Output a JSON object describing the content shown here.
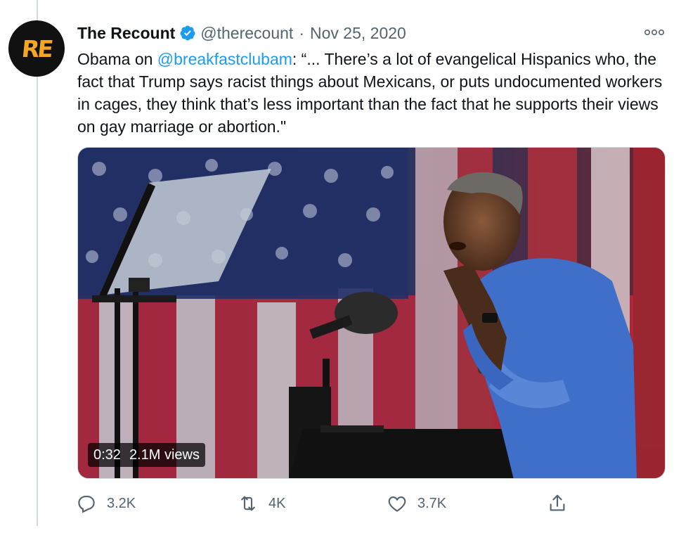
{
  "tweet": {
    "author": {
      "display_name": "The Recount",
      "handle": "@therecount",
      "verified": true,
      "avatar_text": "RE",
      "avatar_color": "#f5a623"
    },
    "separator": "·",
    "date": "Nov 25, 2020",
    "text_prefix": "Obama on ",
    "mention": "@breakfastclubam",
    "text_body": ": “... There’s a lot of evangelical Hispanics who, the fact that Trump says racist things about Mexicans, or puts undocumented workers in cages, they think that’s less important than the fact that he supports their views on gay marriage or abortion.\"",
    "media": {
      "type": "video",
      "duration": "0:32",
      "views": "2.1M views"
    },
    "actions": {
      "replies": "3.2K",
      "retweets": "4K",
      "likes": "3.7K"
    }
  },
  "colors": {
    "link": "#1d9bf0",
    "secondary_text": "#536471",
    "verified_badge": "#1d9bf0"
  },
  "icons": [
    "more-icon",
    "verified-icon",
    "reply-icon",
    "retweet-icon",
    "like-icon",
    "share-icon"
  ]
}
